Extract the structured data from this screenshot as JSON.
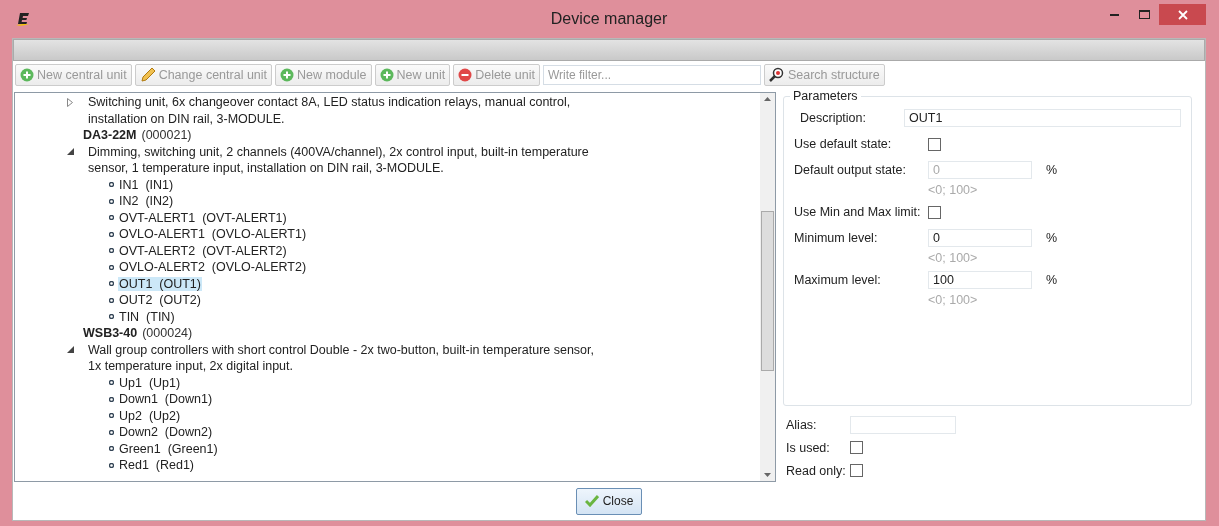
{
  "window": {
    "title": "Device manager"
  },
  "toolbar": [
    {
      "label": "New central unit",
      "kind": "add",
      "disabled": true
    },
    {
      "label": "Change central unit",
      "kind": "edit",
      "disabled": true
    },
    {
      "label": "New module",
      "kind": "add",
      "disabled": true
    },
    {
      "label": "New unit",
      "kind": "add",
      "disabled": true
    },
    {
      "label": "Delete unit",
      "kind": "delete",
      "disabled": true
    }
  ],
  "filter": {
    "placeholder": "Write filter..."
  },
  "search_button": {
    "label": "Search structure",
    "disabled": true
  },
  "tree": [
    {
      "description": "Switching unit, 6x changeover contact 8A, LED status indication relays, manual control, installation on DIN rail, 3-MODULE.",
      "expanded": false
    },
    {
      "name": "DA3-22M",
      "code": "(000021)",
      "description": "Dimming, switching unit, 2 channels (400VA/channel), 2x control input, built-in temperature sensor, 1 temperature input, installation on DIN rail, 3-MODULE.",
      "expanded": true,
      "children": [
        {
          "label": "IN1  (IN1)",
          "selected": false
        },
        {
          "label": "IN2  (IN2)",
          "selected": false
        },
        {
          "label": "OVT-ALERT1  (OVT-ALERT1)",
          "selected": false
        },
        {
          "label": "OVLO-ALERT1  (OVLO-ALERT1)",
          "selected": false
        },
        {
          "label": "OVT-ALERT2  (OVT-ALERT2)",
          "selected": false
        },
        {
          "label": "OVLO-ALERT2  (OVLO-ALERT2)",
          "selected": false
        },
        {
          "label": "OUT1  (OUT1)",
          "selected": true
        },
        {
          "label": "OUT2  (OUT2)",
          "selected": false
        },
        {
          "label": "TIN  (TIN)",
          "selected": false
        }
      ]
    },
    {
      "name": "WSB3-40",
      "code": "(000024)",
      "description": "Wall group controllers with short control Double - 2x two-button, built-in temperature sensor, 1x temperature input, 2x digital input.",
      "expanded": true,
      "children": [
        {
          "label": "Up1  (Up1)",
          "selected": false
        },
        {
          "label": "Down1  (Down1)",
          "selected": false
        },
        {
          "label": "Up2  (Up2)",
          "selected": false
        },
        {
          "label": "Down2  (Down2)",
          "selected": false
        },
        {
          "label": "Green1  (Green1)",
          "selected": false
        },
        {
          "label": "Red1  (Red1)",
          "selected": false
        }
      ]
    }
  ],
  "parameters": {
    "title": "Parameters",
    "rows": [
      {
        "kind": "text",
        "label": "Description:",
        "value": "OUT1"
      },
      {
        "kind": "checkbox",
        "label": "Use default state:",
        "checked": false
      },
      {
        "kind": "number",
        "label": "Default output state:",
        "value": "0",
        "unit": "%",
        "range": "<0; 100>",
        "disabled": true
      },
      {
        "kind": "checkbox",
        "label": "Use Min and Max limit:",
        "checked": false
      },
      {
        "kind": "number",
        "label": "Minimum level:",
        "value": "0",
        "unit": "%",
        "range": "<0; 100>",
        "disabled": false
      },
      {
        "kind": "number",
        "label": "Maximum level:",
        "value": "100",
        "unit": "%",
        "range": "<0; 100>",
        "disabled": false
      }
    ]
  },
  "extra": [
    {
      "kind": "text",
      "label": "Alias:"
    },
    {
      "kind": "checkbox",
      "label": "Is used:",
      "checked": false
    },
    {
      "kind": "checkbox",
      "label": "Read only:",
      "checked": false
    }
  ],
  "close_button": {
    "label": "Close"
  }
}
